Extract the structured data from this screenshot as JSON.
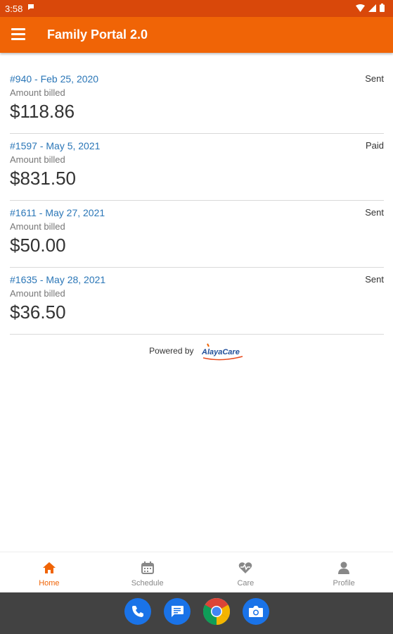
{
  "status_bar": {
    "time": "3:58"
  },
  "app_bar": {
    "title": "Family Portal 2.0"
  },
  "invoices": [
    {
      "number_date": "#940 - Feb 25, 2020",
      "status": "Sent",
      "label": "Amount billed",
      "amount": "$118.86"
    },
    {
      "number_date": "#1597 - May 5, 2021",
      "status": "Paid",
      "label": "Amount billed",
      "amount": "$831.50"
    },
    {
      "number_date": "#1611 - May 27, 2021",
      "status": "Sent",
      "label": "Amount billed",
      "amount": "$50.00"
    },
    {
      "number_date": "#1635 - May 28, 2021",
      "status": "Sent",
      "label": "Amount billed",
      "amount": "$36.50"
    }
  ],
  "powered_by": {
    "text": "Powered by",
    "logo_text": "AlayaCare"
  },
  "bottom_nav": [
    {
      "label": "Home",
      "icon": "home-icon",
      "active": true
    },
    {
      "label": "Schedule",
      "icon": "calendar-icon",
      "active": false
    },
    {
      "label": "Care",
      "icon": "heart-pulse-icon",
      "active": false
    },
    {
      "label": "Profile",
      "icon": "person-icon",
      "active": false
    }
  ],
  "dock": [
    {
      "icon": "phone-icon"
    },
    {
      "icon": "messages-icon"
    },
    {
      "icon": "chrome-icon"
    },
    {
      "icon": "camera-icon"
    }
  ],
  "colors": {
    "primary": "#f06406",
    "status_bar": "#d9480a",
    "link": "#2a76b7",
    "system_bar": "#424242"
  }
}
